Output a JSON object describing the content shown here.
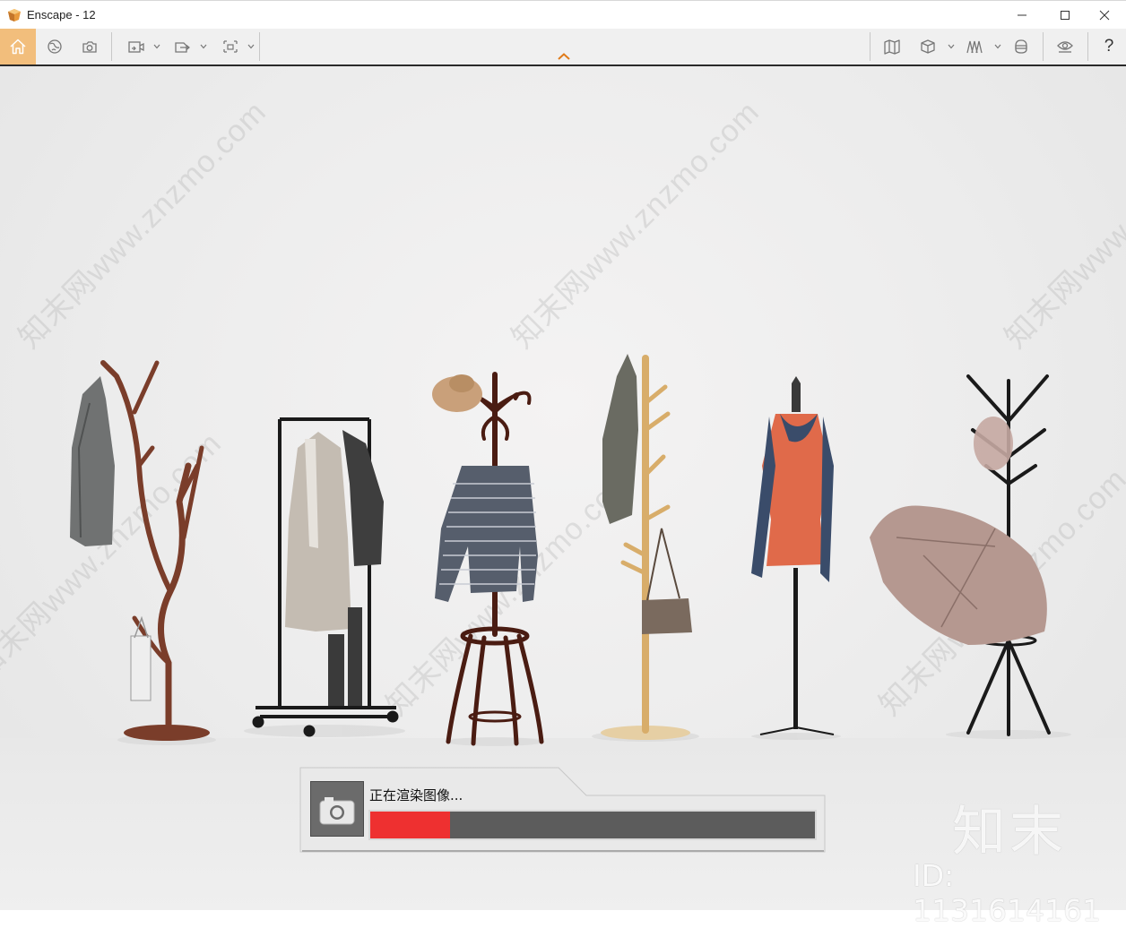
{
  "window": {
    "title": "Enscape - 12",
    "icons": {
      "app": "enscape-logo-icon",
      "minimize": "minimize-icon",
      "maximize": "maximize-icon",
      "close": "close-icon"
    }
  },
  "toolbar": {
    "left_icons": [
      "home-icon",
      "orbit-icon",
      "screenshot-icon",
      "video-path-icon",
      "export-icon",
      "batch-render-icon"
    ],
    "right_icons": [
      "map-icon",
      "box-icon",
      "asset-library-icon",
      "vr-headset-icon",
      "visual-settings-icon"
    ],
    "help_label": "?",
    "accent_color": "#f2be7c",
    "caret_color": "#e07b1a"
  },
  "viewport": {
    "watermark_text": "知末网www.znzmo.com"
  },
  "render_dialog": {
    "status": "正在渲染图像...",
    "progress": 0.18,
    "progress_color": "#ee3030",
    "icon": "camera-icon"
  },
  "watermark": {
    "logo": "知末",
    "id": "ID: 1131614161"
  }
}
